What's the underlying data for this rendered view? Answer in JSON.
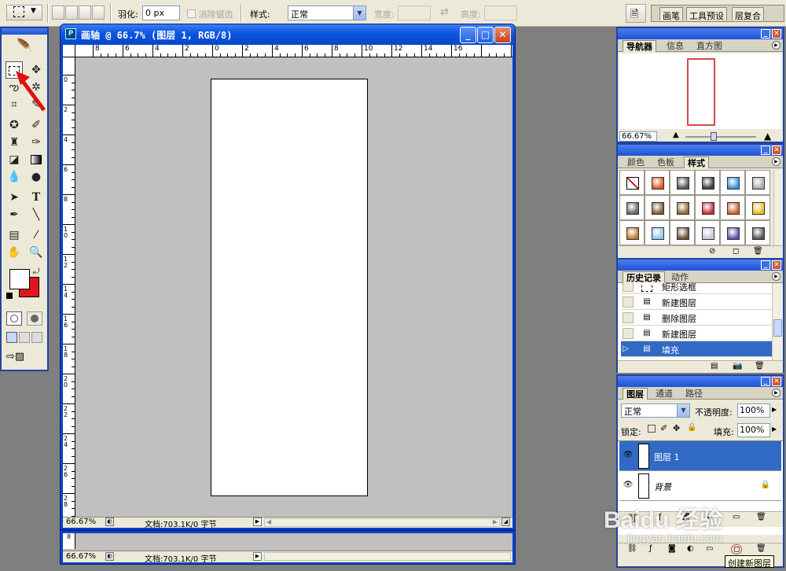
{
  "options_bar": {
    "feather_label": "羽化:",
    "feather_value": "0 px",
    "antialias_label": "消除锯齿",
    "style_label": "样式:",
    "style_value": "正常",
    "width_label": "宽度:",
    "height_label": "高度:",
    "palette_well_tabs": [
      "画笔",
      "工具预设",
      "层复合"
    ]
  },
  "document": {
    "title": "画轴 @ 66.7% (图层 1, RGB/8)",
    "zoom": "66.67%",
    "doc_info": "文档:703.1K/0 字节",
    "h_ruler": [
      "8",
      "6",
      "4",
      "2",
      "0",
      "2",
      "4",
      "6",
      "8",
      "10",
      "12",
      "14",
      "16"
    ],
    "v_ruler": [
      "0",
      "2",
      "4",
      "6",
      "8",
      "1\n0",
      "1\n2",
      "1\n4",
      "1\n6",
      "1\n8",
      "2\n0",
      "2\n2",
      "2\n4",
      "2\n6",
      "2\n8"
    ]
  },
  "document2": {
    "zoom": "66.67%",
    "doc_info": "文档:703.1K/0 字节",
    "v_ruler_label": "8"
  },
  "navigator": {
    "tabs": [
      "导航器",
      "信息",
      "直方图"
    ],
    "zoom": "66.67%"
  },
  "styles_panel": {
    "tabs": [
      "颜色",
      "色板",
      "样式"
    ],
    "swatches": [
      "#ffffff",
      "#e8531a",
      "#555555",
      "#3a3a3a",
      "#3a8fd8",
      "#aaaaaa",
      "#666666",
      "#7a5a30",
      "#8a6a30",
      "#c8283a",
      "#d06030",
      "#e8c020",
      "#c07830",
      "#8ec8ec",
      "#6a5030",
      "#c8c8d8",
      "#6050b0",
      "#555555"
    ]
  },
  "history": {
    "tabs": [
      "历史记录",
      "动作"
    ],
    "items": [
      "矩形选框",
      "新建图层",
      "删除图层",
      "新建图层",
      "填充"
    ],
    "selected_index": 4
  },
  "layers": {
    "tabs": [
      "图层",
      "通道",
      "路径"
    ],
    "blend_mode": "正常",
    "opacity_label": "不透明度:",
    "opacity_value": "100%",
    "lock_label": "锁定:",
    "fill_label": "填充:",
    "fill_value": "100%",
    "items": [
      "图层 1",
      "背景"
    ]
  },
  "tooltip": "创建新图层",
  "watermark": "Baidu 经验",
  "watermark_url": "jingyan.baidu.com",
  "colors": {
    "window_blue": "#0a42c4",
    "panel_bg": "#ece9d8",
    "selection": "#316ac5",
    "background_color": "#e0141e",
    "arrow_red": "#e01010"
  }
}
